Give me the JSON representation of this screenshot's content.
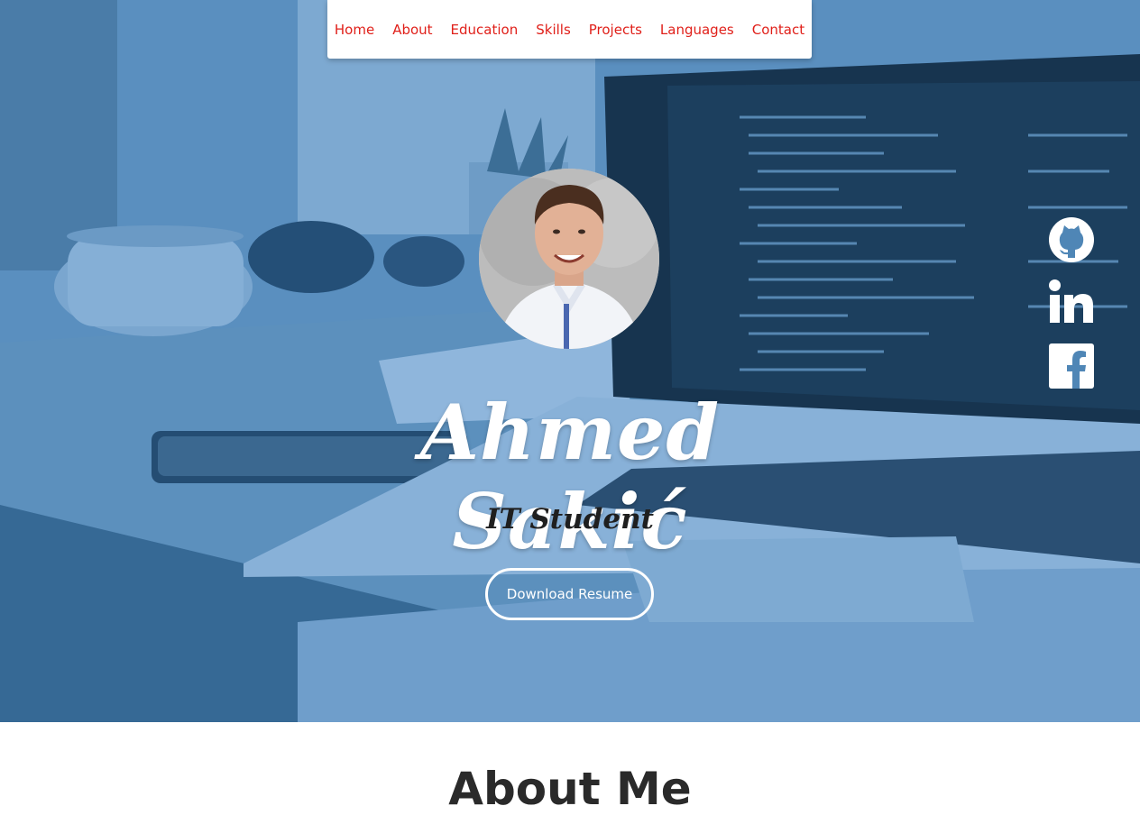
{
  "nav": {
    "items": [
      {
        "label": "Home"
      },
      {
        "label": "About"
      },
      {
        "label": "Education"
      },
      {
        "label": "Skills"
      },
      {
        "label": "Projects"
      },
      {
        "label": "Languages"
      },
      {
        "label": "Contact"
      }
    ],
    "link_color": "#e0201a"
  },
  "hero": {
    "name": "Ahmed Sakić",
    "subtitle": "IT Student",
    "resume_button": "Download Resume",
    "overlay_color": "#4f86b6",
    "background_image": "laptop-with-code-on-desk",
    "avatar_image": "profile-photo"
  },
  "social": [
    {
      "icon": "github-icon"
    },
    {
      "icon": "linkedin-icon"
    },
    {
      "icon": "facebook-icon"
    }
  ],
  "about": {
    "title": "About Me"
  }
}
